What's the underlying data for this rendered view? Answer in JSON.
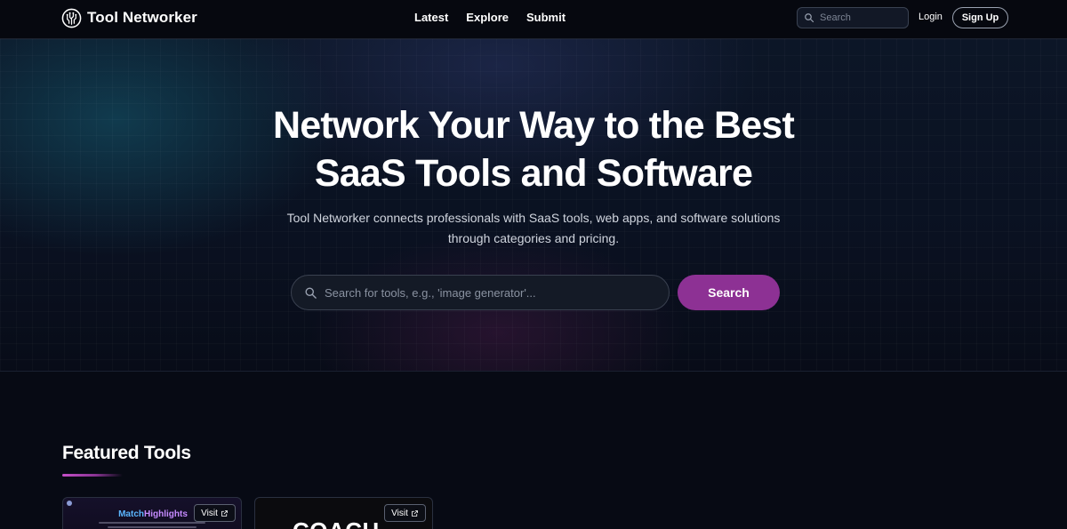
{
  "header": {
    "brand_name": "Tool Networker",
    "nav": [
      {
        "label": "Latest"
      },
      {
        "label": "Explore"
      },
      {
        "label": "Submit"
      }
    ],
    "search_placeholder": "Search",
    "login_label": "Login",
    "signup_label": "Sign Up"
  },
  "hero": {
    "title_line1": "Network Your Way to the Best",
    "title_line2": "SaaS Tools and Software",
    "subtitle_line1": "Tool Networker connects professionals with SaaS tools, web apps, and software solutions",
    "subtitle_line2": "through categories and pricing.",
    "search_placeholder": "Search for tools, e.g., 'image generator'...",
    "search_button": "Search"
  },
  "featured": {
    "title": "Featured Tools",
    "cards": [
      {
        "preview_title_part1": "Match",
        "preview_title_part2": "Highlights",
        "visit_label": "Visit"
      },
      {
        "preview_text": "COACH",
        "visit_label": "Visit"
      }
    ]
  },
  "colors": {
    "accent": "#8d3194",
    "background": "#070a14"
  }
}
